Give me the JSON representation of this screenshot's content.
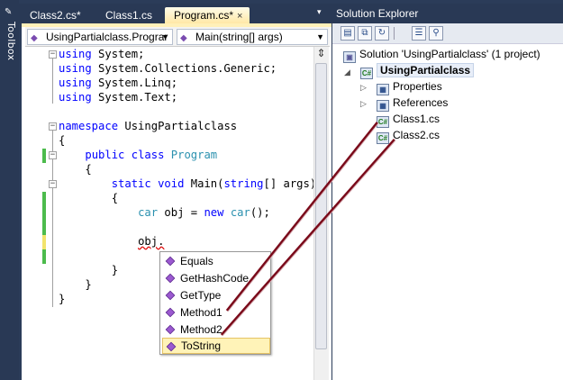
{
  "toolbox": {
    "label": "Toolbox",
    "pin_icon": "pin-icon"
  },
  "editor": {
    "tabs": [
      {
        "label": "Class2.cs*",
        "active": false
      },
      {
        "label": "Class1.cs",
        "active": false
      },
      {
        "label": "Program.cs*",
        "active": true
      }
    ],
    "tab_close_glyph": "×",
    "tab_dropdown_glyph": "▾",
    "navbar": {
      "type_combo": "UsingPartialclass.Prograr",
      "member_combo": "Main(string[] args)"
    },
    "code_lines": [
      "using System;",
      "using System.Collections.Generic;",
      "using System.Linq;",
      "using System.Text;",
      "",
      "namespace UsingPartialclass",
      "{",
      "    public class Program",
      "    {",
      "        static void Main(string[] args)",
      "        {",
      "            car obj = new car();",
      "",
      "            obj.",
      "",
      "        }",
      "    }",
      "}"
    ]
  },
  "intellisense": {
    "items": [
      "Equals",
      "GetHashCode",
      "GetType",
      "Method1",
      "Method2",
      "ToString"
    ],
    "selected": "ToString"
  },
  "solution_explorer": {
    "title": "Solution Explorer",
    "solution": "Solution 'UsingPartialclass' (1 project)",
    "project": "UsingPartialclass",
    "items": [
      "Properties",
      "References",
      "Class1.cs",
      "Class2.cs"
    ],
    "cs_icon_text": "C#"
  },
  "colors": {
    "keyword": "#0000ff",
    "type": "#2b91af",
    "arrow": "#7a0a1a",
    "chrome": "#293955"
  }
}
